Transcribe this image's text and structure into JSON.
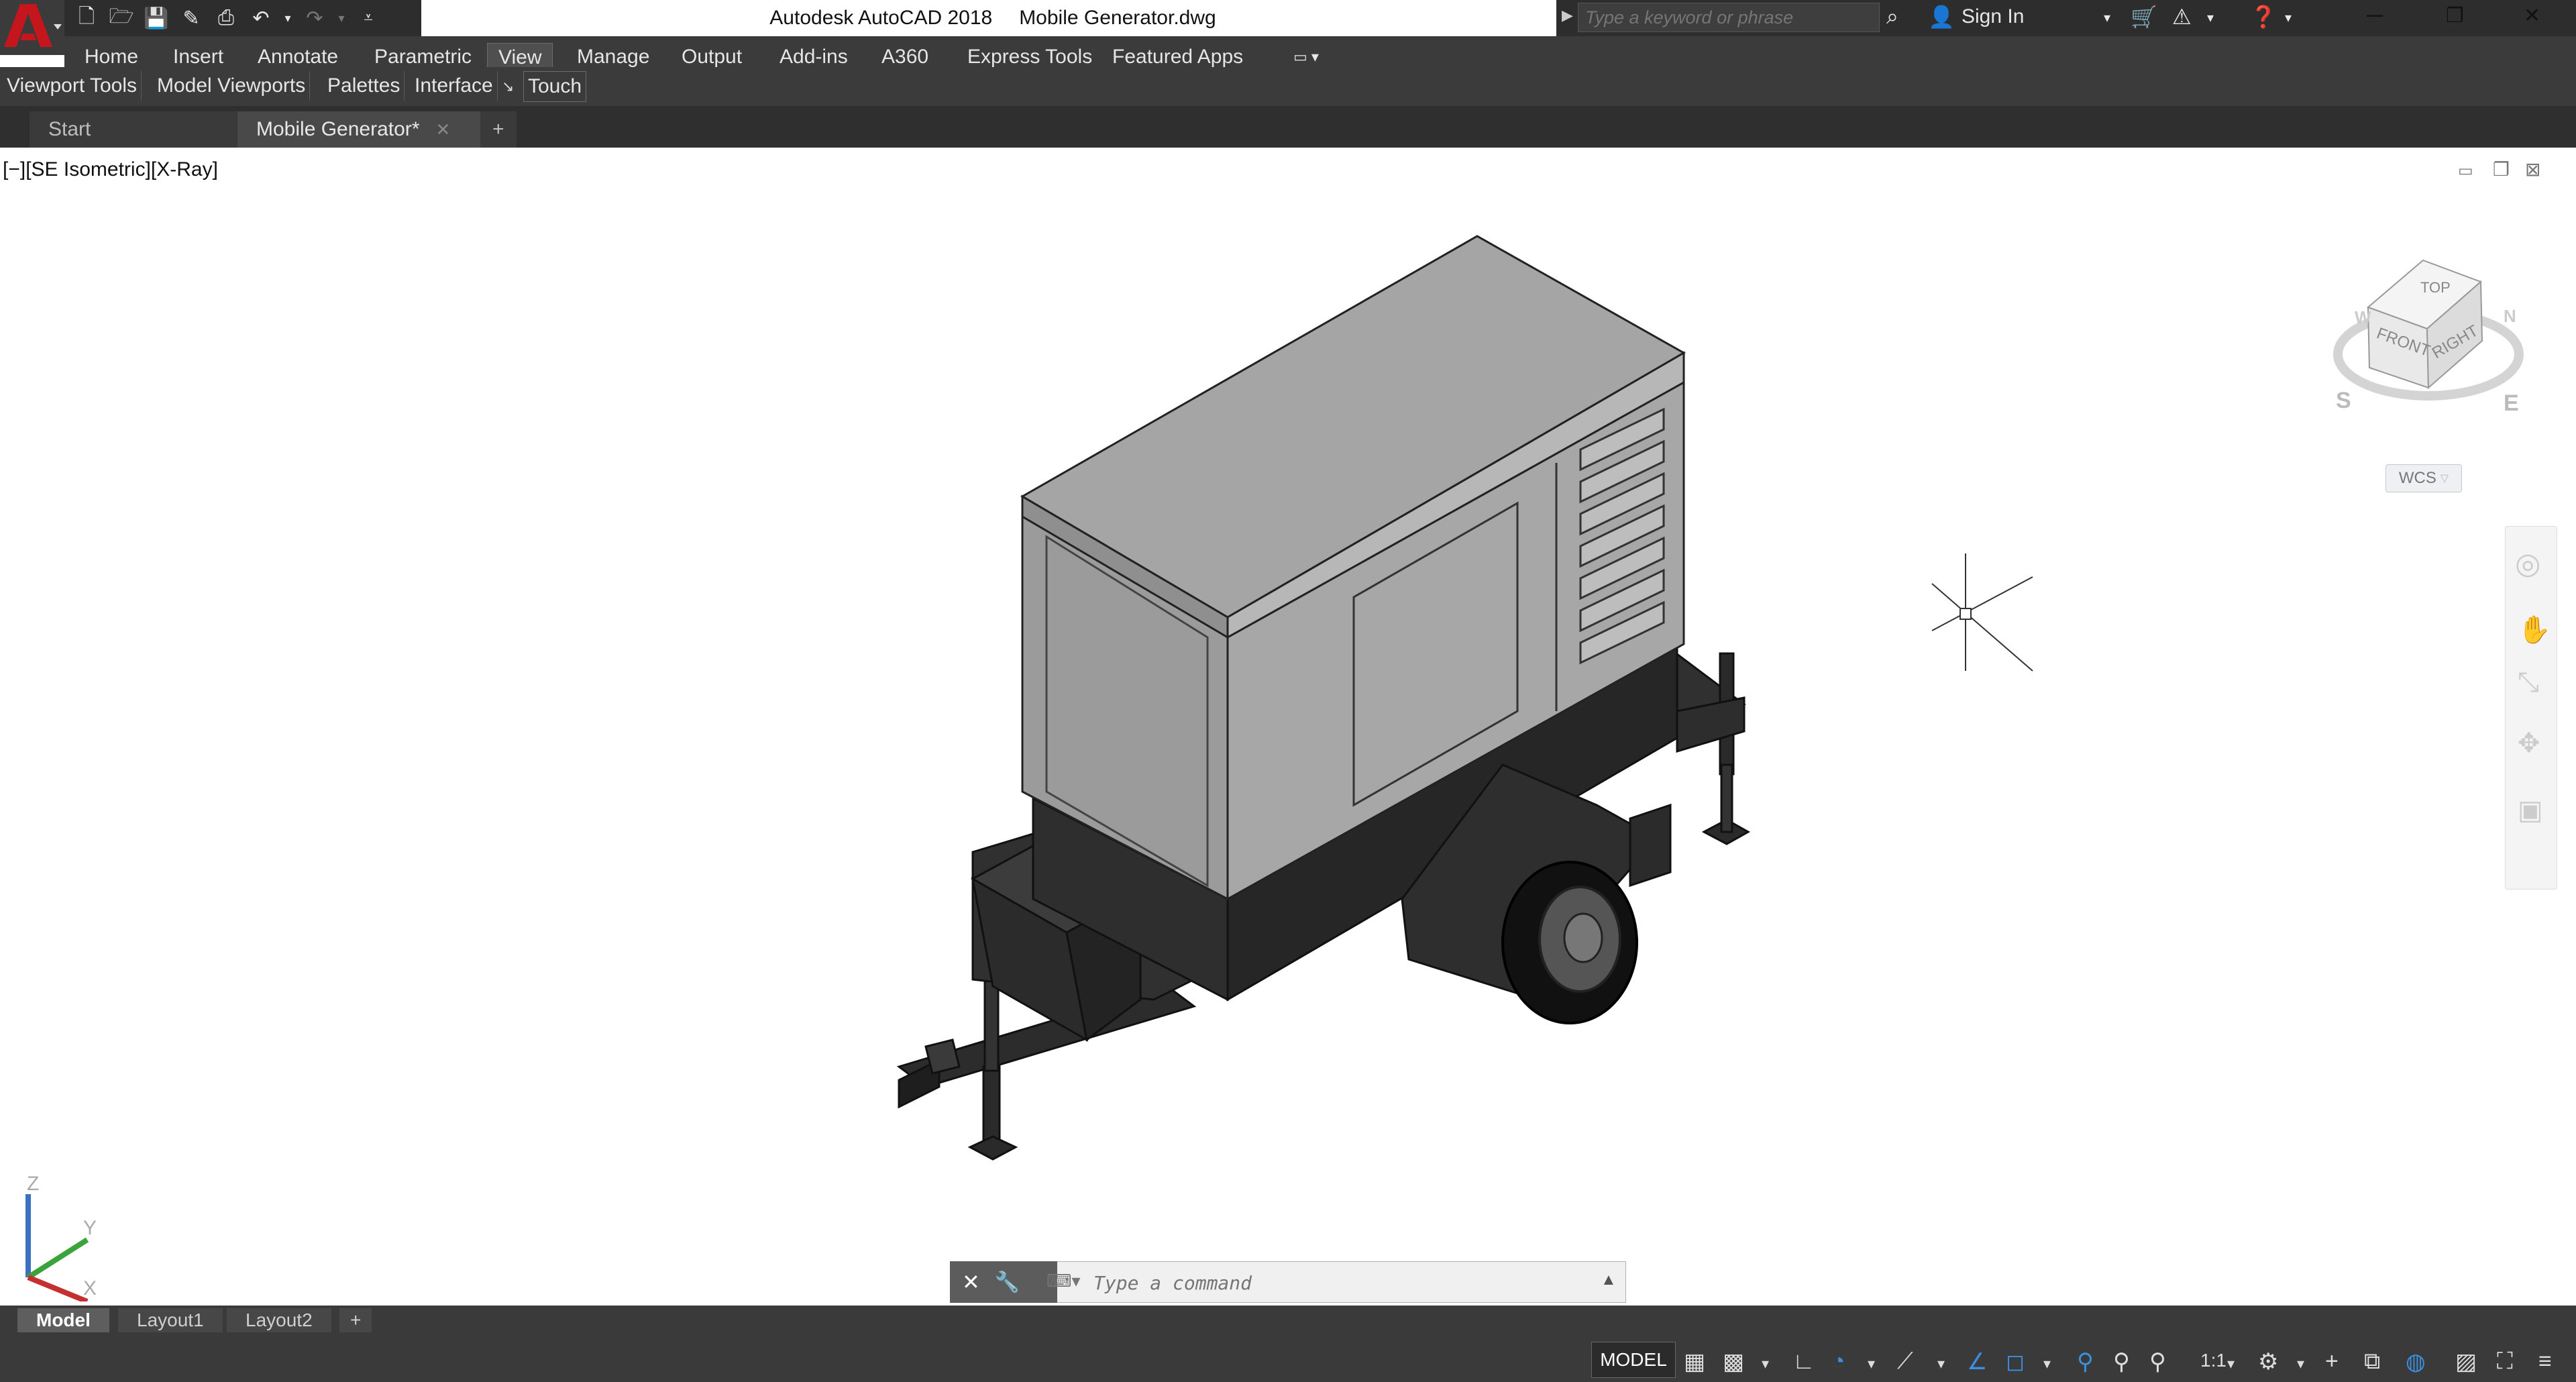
{
  "window": {
    "app_name": "Autodesk AutoCAD 2018",
    "file_name": "Mobile Generator.dwg",
    "controls": {
      "minimize": "─",
      "restore": "❐",
      "close": "✕"
    }
  },
  "app_logo": "A",
  "quick_access": [
    "new-icon",
    "open-icon",
    "save-icon",
    "saveas-icon",
    "plot-icon",
    "undo-icon",
    "redo-icon",
    "customize-icon"
  ],
  "search": {
    "placeholder": "Type a keyword or phrase"
  },
  "signin": {
    "label": "Sign In"
  },
  "ribbon": {
    "tabs": [
      "Home",
      "Insert",
      "Annotate",
      "Parametric",
      "View",
      "Manage",
      "Output",
      "Add-ins",
      "A360",
      "Express Tools",
      "Featured Apps"
    ],
    "active_tab": "View",
    "panels": [
      "Viewport Tools",
      "Model Viewports",
      "Palettes",
      "Interface",
      "Touch"
    ]
  },
  "file_tabs": {
    "start": "Start",
    "document": "Mobile Generator*"
  },
  "viewport": {
    "label": "[−][SE Isometric][X-Ray]"
  },
  "viewcube": {
    "top": "TOP",
    "front": "FRONT",
    "right": "RIGHT",
    "wcs": "WCS",
    "south": "S",
    "east": "E",
    "west": "W",
    "north": "N"
  },
  "ucs": {
    "z": "Z",
    "y": "Y",
    "x": "X"
  },
  "command": {
    "placeholder": "Type a command"
  },
  "layout_tabs": [
    "Model",
    "Layout1",
    "Layout2"
  ],
  "status": {
    "model": "MODEL",
    "scale": "1:1"
  },
  "colors": {
    "dark_bg": "#3b3b3b",
    "logo_red": "#c4161c",
    "generator_body": "#a4a4a4",
    "trailer": "#2f2f2f"
  }
}
